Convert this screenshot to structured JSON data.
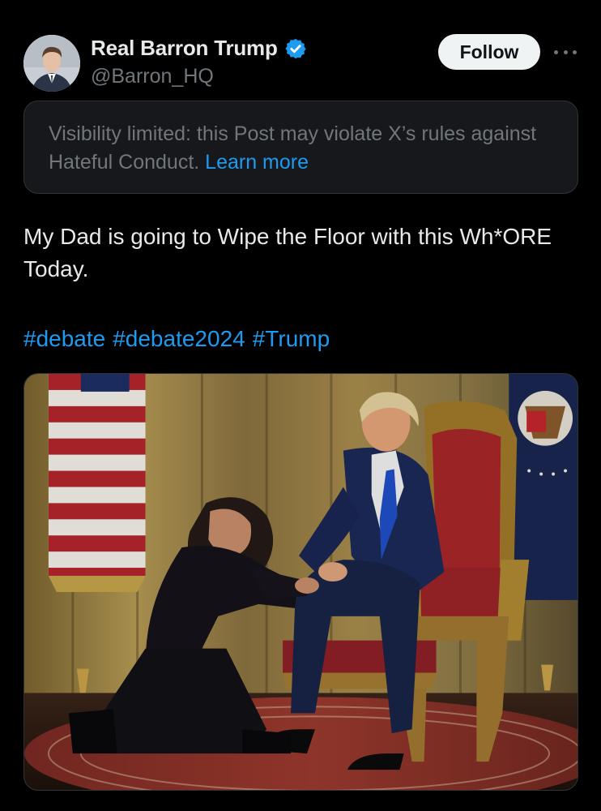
{
  "author": {
    "display_name": "Real Barron Trump",
    "handle": "@Barron_HQ",
    "verified": true,
    "verified_color": "#1d9bf0"
  },
  "actions": {
    "follow_label": "Follow"
  },
  "notice": {
    "text": "Visibility limited: this Post may violate X’s rules against Hateful Conduct.",
    "link_label": "Learn more"
  },
  "post": {
    "text": "My Dad is going to Wipe the Floor with this Wh*ORE Today.",
    "hashtags": [
      "#debate",
      "#debate2024",
      "#Trump"
    ]
  },
  "colors": {
    "background": "#000000",
    "link": "#1d9bf0",
    "muted": "#71767b",
    "text": "#e7e9ea"
  }
}
